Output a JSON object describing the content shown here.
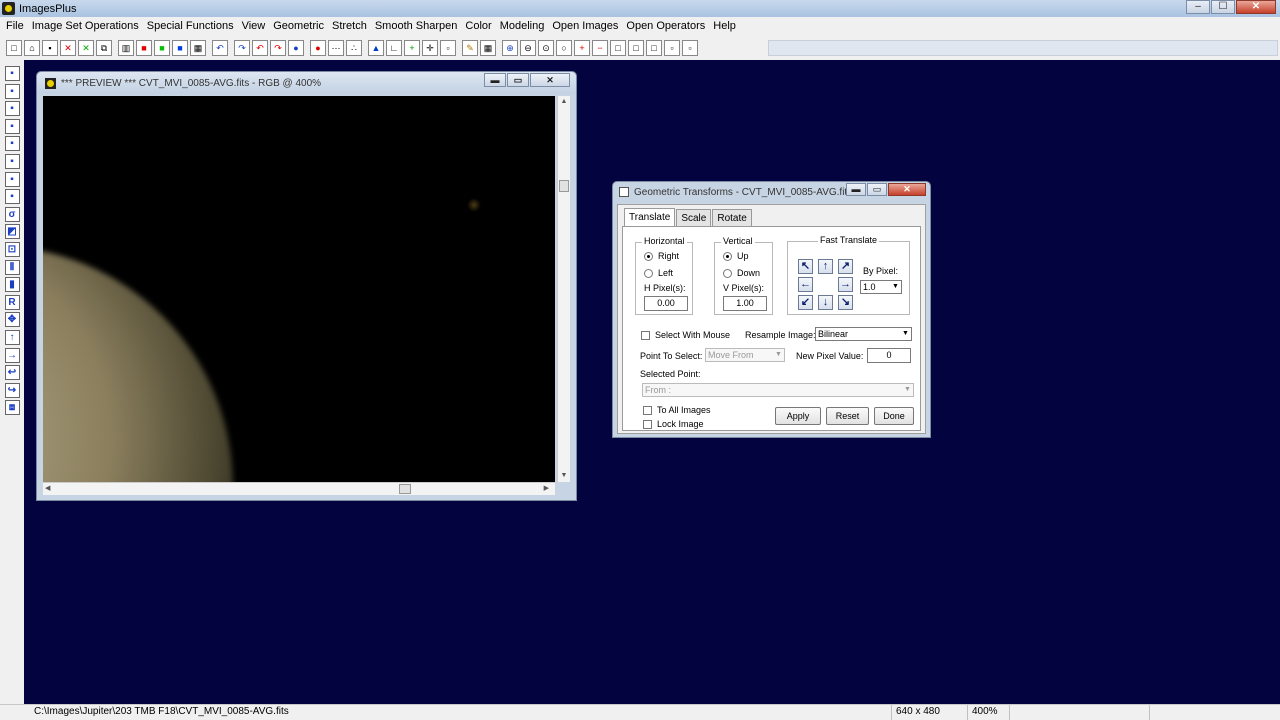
{
  "app": {
    "title": "ImagesPlus",
    "window_buttons": {
      "minimize": "–",
      "maximize": "☐",
      "close": "✕"
    }
  },
  "menu": [
    "File",
    "Image Set Operations",
    "Special Functions",
    "View",
    "Geometric",
    "Stretch",
    "Smooth Sharpen",
    "Color",
    "Modeling",
    "Open Images",
    "Open Operators",
    "Help"
  ],
  "toolbar": {
    "buttons": [
      {
        "name": "new-icon",
        "glyph": "□"
      },
      {
        "name": "open-icon",
        "glyph": "⌂"
      },
      {
        "name": "save-icon",
        "glyph": "▪"
      },
      {
        "name": "close-image-icon",
        "glyph": "✕"
      },
      {
        "name": "cancel-icon",
        "glyph": "✕"
      },
      {
        "name": "copy-icon",
        "glyph": "⧉"
      },
      {
        "name": "rgb-channels-icon",
        "glyph": "▥"
      },
      {
        "name": "red-channel-icon",
        "glyph": "■"
      },
      {
        "name": "green-channel-icon",
        "glyph": "■"
      },
      {
        "name": "blue-channel-icon",
        "glyph": "■"
      },
      {
        "name": "grid-icon",
        "glyph": "▦"
      },
      {
        "name": "undo-icon",
        "glyph": "↶"
      },
      {
        "name": "redo-icon",
        "glyph": "↷"
      },
      {
        "name": "undo-all-icon",
        "glyph": "↶"
      },
      {
        "name": "redo-all-icon",
        "glyph": "↷"
      },
      {
        "name": "record-icon",
        "glyph": "●"
      },
      {
        "name": "record-red-icon",
        "glyph": "●"
      },
      {
        "name": "dots-icon",
        "glyph": "⋯"
      },
      {
        "name": "points-icon",
        "glyph": "∴"
      },
      {
        "name": "histogram-icon",
        "glyph": "▲"
      },
      {
        "name": "axis-icon",
        "glyph": "∟"
      },
      {
        "name": "add-icon",
        "glyph": "+"
      },
      {
        "name": "crosshair-icon",
        "glyph": "✛"
      },
      {
        "name": "frame-icon",
        "glyph": "▫"
      },
      {
        "name": "pencil-icon",
        "glyph": "✎"
      },
      {
        "name": "grid-select-icon",
        "glyph": "▦"
      },
      {
        "name": "zoom-in-icon",
        "glyph": "⊕"
      },
      {
        "name": "zoom-out-icon",
        "glyph": "⊖"
      },
      {
        "name": "zoom-fit-icon",
        "glyph": "⊙"
      },
      {
        "name": "zoom-reset-icon",
        "glyph": "○"
      },
      {
        "name": "plus-box-icon",
        "glyph": "+"
      },
      {
        "name": "minus-box-icon",
        "glyph": "−"
      },
      {
        "name": "box-1-icon",
        "glyph": "□"
      },
      {
        "name": "box-2-icon",
        "glyph": "□"
      },
      {
        "name": "box-3-icon",
        "glyph": "□"
      },
      {
        "name": "box-4-icon",
        "glyph": "▫"
      },
      {
        "name": "box-5-icon",
        "glyph": "▫"
      }
    ]
  },
  "leftbar": [
    "▪",
    "▪",
    "▪",
    "▪",
    "▪",
    "▪",
    "▪",
    "▪",
    "σ",
    "◩",
    "⊡",
    "⫴",
    "▮",
    "R",
    "✥",
    "↑",
    "→",
    "↩",
    "↪",
    "⧈"
  ],
  "preview": {
    "title": "*** PREVIEW *** CVT_MVI_0085-AVG.fits - RGB @ 400%",
    "buttons": {
      "minimize": "▬",
      "maximize": "▭",
      "close": "✕"
    }
  },
  "dialog": {
    "title": "Geometric Transforms - CVT_MVI_0085-AVG.fit...",
    "buttons": {
      "minimize": "▬",
      "maximize": "▭",
      "close": "✕"
    },
    "tabs": [
      "Translate",
      "Scale",
      "Rotate"
    ],
    "horizontal": {
      "label": "Horizontal",
      "opt_right": "Right",
      "opt_left": "Left",
      "pixels_label": "H Pixel(s):",
      "pixels_value": "0.00"
    },
    "vertical": {
      "label": "Vertical",
      "opt_up": "Up",
      "opt_down": "Down",
      "pixels_label": "V Pixel(s):",
      "pixels_value": "1.00"
    },
    "fast": {
      "label": "Fast Translate",
      "by_pixel_label": "By Pixel:",
      "by_pixel_value": "1.0",
      "arrows": {
        "up_left": "↖",
        "up": "↑",
        "up_right": "↗",
        "left": "←",
        "right": "→",
        "down_left": "↙",
        "down": "↓",
        "down_right": "↘"
      }
    },
    "select_with_mouse": "Select With Mouse",
    "resample_label": "Resample Image:",
    "resample_value": "Bilinear",
    "point_to_select_label": "Point To Select:",
    "point_to_select_value": "Move From",
    "new_pixel_label": "New Pixel Value:",
    "new_pixel_value": "0",
    "selected_point_label": "Selected Point:",
    "selected_point_value": "From :",
    "to_all_images": "To All Images",
    "lock_image": "Lock Image",
    "apply": "Apply",
    "reset": "Reset",
    "done": "Done"
  },
  "status": {
    "path": "C:\\Images\\Jupiter\\203 TMB F18\\CVT_MVI_0085-AVG.fits",
    "dimensions": "640 x 480",
    "zoom": "400%"
  }
}
